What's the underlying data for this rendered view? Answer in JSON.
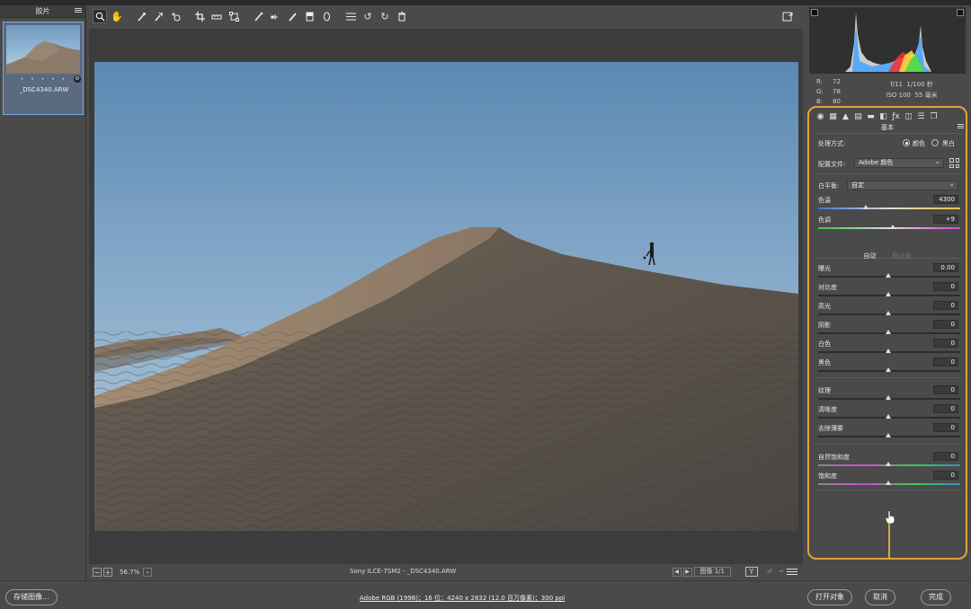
{
  "filmstrip": {
    "title": "胶片",
    "thumb_stars": "• • • • •",
    "thumb_name": "_DSC4340.ARW",
    "badge": "⚙"
  },
  "toolbar": {
    "tools": [
      "zoom-icon",
      "hand-icon",
      "white-balance-icon",
      "color-sampler-icon",
      "target-adjust-icon",
      "crop-icon",
      "straighten-icon",
      "transform-icon",
      "spot-removal-icon",
      "redeye-icon",
      "adjustment-brush-icon",
      "graduated-filter-icon",
      "radial-filter-icon",
      "presets-list-icon",
      "rotate-left-icon",
      "rotate-right-icon",
      "trash-icon"
    ]
  },
  "bottom": {
    "zoom_minus": "−",
    "zoom_plus": "+",
    "zoom": "56.7%",
    "camera_file": "Sony ILCE-7SM2 - _DSC4340.ARW",
    "image_num": "图像 1/1",
    "yy": "Y",
    "prev": "◀",
    "next": "▶"
  },
  "readout": {
    "r_label": "R:",
    "r": "72",
    "g_label": "G:",
    "g": "78",
    "b_label": "B:",
    "b": "80",
    "aperture": "f/11",
    "shutter": "1/100 秒",
    "iso": "ISO 100",
    "focal": "55 毫米"
  },
  "panel": {
    "title": "基本",
    "process_label": "处理方式:",
    "process_color": "颜色",
    "process_bw": "黑白",
    "profile_label": "配置文件:",
    "profile_value": "Adobe 颜色",
    "wb_label": "白平衡:",
    "wb_value": "自定",
    "auto": "自动",
    "default": "默认值",
    "sliders": {
      "temp": {
        "label": "色温",
        "value": "4300",
        "pos": 0.34
      },
      "tint": {
        "label": "色调",
        "value": "+9",
        "pos": 0.53
      },
      "exposure": {
        "label": "曝光",
        "value": "0.00",
        "pos": 0.5
      },
      "contrast": {
        "label": "对比度",
        "value": "0",
        "pos": 0.5
      },
      "highlights": {
        "label": "高光",
        "value": "0",
        "pos": 0.5
      },
      "shadows": {
        "label": "阴影",
        "value": "0",
        "pos": 0.5
      },
      "whites": {
        "label": "白色",
        "value": "0",
        "pos": 0.5
      },
      "blacks": {
        "label": "黑色",
        "value": "0",
        "pos": 0.5
      },
      "texture": {
        "label": "纹理",
        "value": "0",
        "pos": 0.5
      },
      "clarity": {
        "label": "清晰度",
        "value": "0",
        "pos": 0.5
      },
      "dehaze": {
        "label": "去除薄雾",
        "value": "0",
        "pos": 0.5
      },
      "vibrance": {
        "label": "自然饱和度",
        "value": "0",
        "pos": 0.5
      },
      "saturation": {
        "label": "饱和度",
        "value": "0",
        "pos": 0.5
      }
    }
  },
  "footer": {
    "save": "存储图像...",
    "info": "Adobe RGB (1998)；16 位；4240 x 2832 (12.0 百万像素)；300 ppi",
    "open": "打开对象",
    "cancel": "取消",
    "done": "完成"
  },
  "colors": {
    "accent": "#e0a43a",
    "selection": "#7aa7e0"
  }
}
